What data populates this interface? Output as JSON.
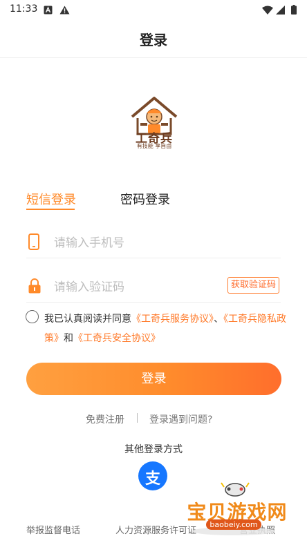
{
  "status_bar": {
    "time": "11:33"
  },
  "header": {
    "title": "登录"
  },
  "logo": {
    "brand_text": "工奇兵",
    "slogan": "有技能 享自由"
  },
  "tabs": {
    "sms": "短信登录",
    "password": "密码登录"
  },
  "form": {
    "phone_placeholder": "请输入手机号",
    "code_placeholder": "请输入验证码",
    "get_code_label": "获取验证码"
  },
  "agreement": {
    "prefix": "我已认真阅读并同意",
    "service_link": "《工奇兵服务协议》",
    "sep": "、",
    "privacy_link": "《工奇兵隐私政策》",
    "and": "和",
    "security_link": "《工奇兵安全协议》"
  },
  "login_button": "登录",
  "links": {
    "register": "免费注册",
    "problem": "登录遇到问题?"
  },
  "other_login": {
    "label": "其他登录方式",
    "alipay_icon_text": "支"
  },
  "footer": {
    "report": "举报监督电话",
    "hr_license": "人力资源服务许可证",
    "license": "营业执照"
  },
  "watermark": {
    "title": "宝贝游戏网",
    "url": "baobeiy.com"
  },
  "colors": {
    "accent": "#ff8a2a",
    "alipay": "#1677ff"
  }
}
